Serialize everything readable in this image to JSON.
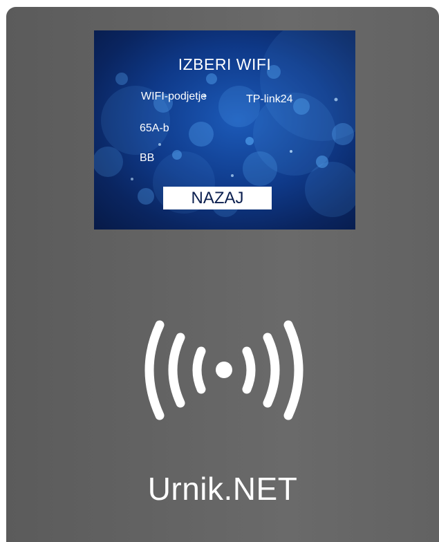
{
  "screen": {
    "title": "IZBERI WIFI",
    "networks": [
      "WIFI-podjetje",
      "TP-link24",
      "65A-b",
      "BB"
    ],
    "back_label": "NAZAJ"
  },
  "device": {
    "brand": "Urnik.NET",
    "reader_icon": "nfc-contactless-icon"
  },
  "colors": {
    "device_body": "#646464",
    "screen_bg": "#0f3a8a",
    "text": "#ffffff"
  }
}
